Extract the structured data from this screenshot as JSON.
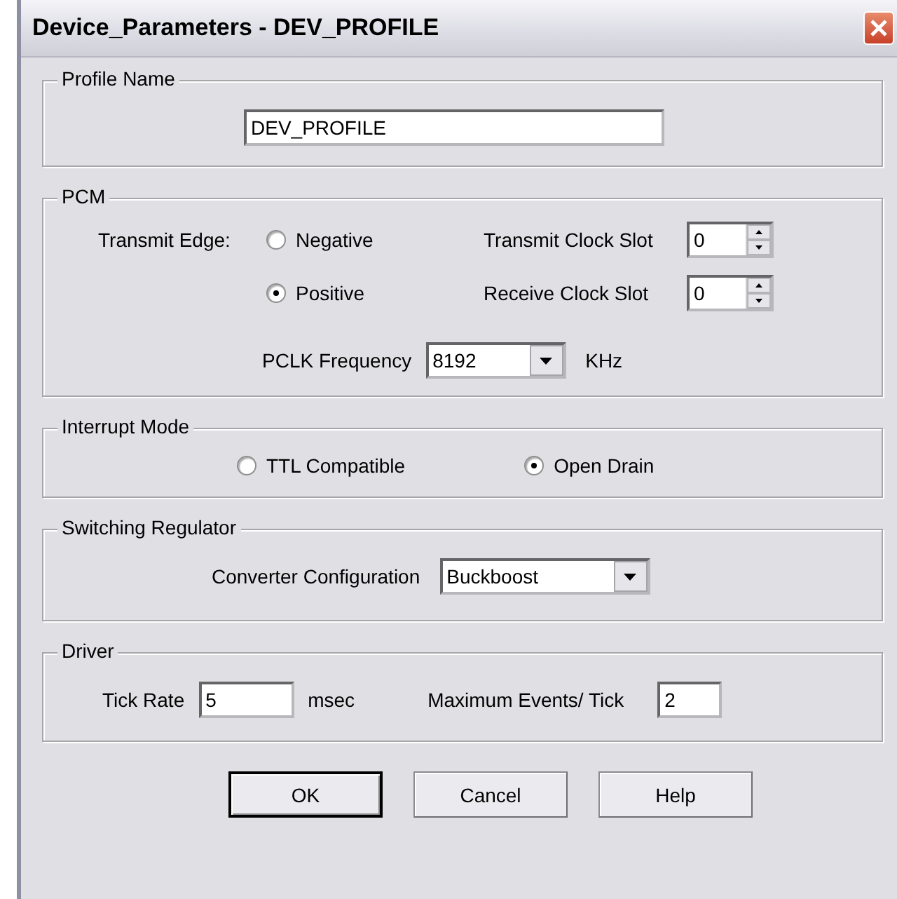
{
  "window": {
    "title": "Device_Parameters - DEV_PROFILE"
  },
  "profile_name": {
    "title": "Profile Name",
    "value": "DEV_PROFILE"
  },
  "pcm": {
    "title": "PCM",
    "transmit_edge": {
      "label": "Transmit Edge:",
      "options": [
        {
          "label": "Negative",
          "selected": false
        },
        {
          "label": "Positive",
          "selected": true
        }
      ]
    },
    "transmit_clock_slot": {
      "label": "Transmit Clock Slot",
      "value": "0"
    },
    "receive_clock_slot": {
      "label": "Receive Clock Slot",
      "value": "0"
    },
    "pclk_frequency": {
      "label": "PCLK Frequency",
      "value": "8192",
      "unit": "KHz"
    }
  },
  "interrupt_mode": {
    "title": "Interrupt Mode",
    "options": [
      {
        "label": "TTL Compatible",
        "selected": false
      },
      {
        "label": "Open Drain",
        "selected": true
      }
    ]
  },
  "switching_regulator": {
    "title": "Switching Regulator",
    "converter_configuration": {
      "label": "Converter Configuration",
      "value": "Buckboost"
    }
  },
  "driver": {
    "title": "Driver",
    "tick_rate": {
      "label": "Tick Rate",
      "value": "5",
      "unit": "msec"
    },
    "max_events": {
      "label": "Maximum Events/ Tick",
      "value": "2"
    }
  },
  "buttons": [
    {
      "label": "OK",
      "default": true
    },
    {
      "label": "Cancel",
      "default": false
    },
    {
      "label": "Help",
      "default": false
    }
  ]
}
